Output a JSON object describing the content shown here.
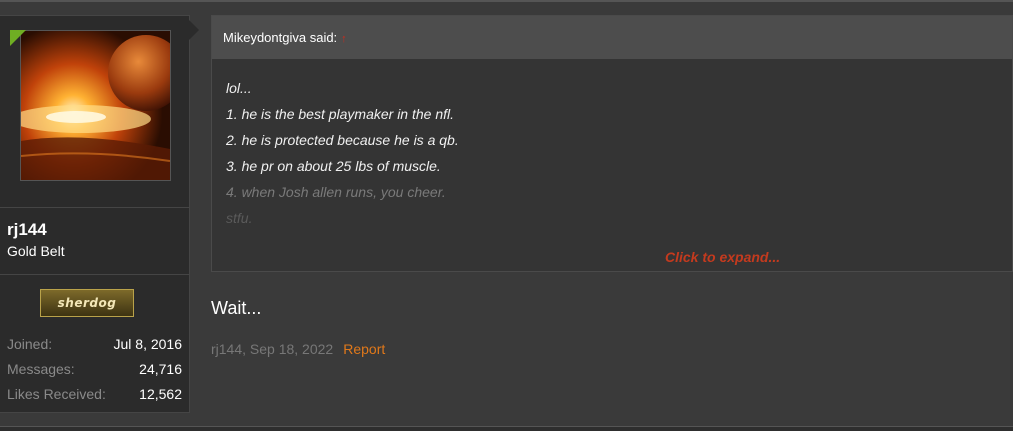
{
  "user": {
    "name": "rj144",
    "title": "Gold Belt",
    "badge": "sherdog",
    "stats": [
      {
        "label": "Joined:",
        "value": "Jul 8, 2016"
      },
      {
        "label": "Messages:",
        "value": "24,716"
      },
      {
        "label": "Likes Received:",
        "value": "12,562"
      }
    ],
    "online_color": "#6fae23"
  },
  "quote": {
    "author_said": "Mikeydontgiva said:",
    "arrow": "↑",
    "lines": [
      "lol...",
      "1. he is the best playmaker in the nfl.",
      "2. he is protected because he is a qb.",
      "3. he pr on about 25 lbs of muscle.",
      "4. when Josh allen runs, you cheer.",
      "stfu."
    ],
    "expand_label": "Click to expand..."
  },
  "post": {
    "message": "Wait...",
    "meta": "rj144, Sep 18, 2022",
    "report_label": "Report"
  },
  "colors": {
    "background": "#3a3a3a",
    "sidebar": "#2b2b2b",
    "accent_red": "#c43a1e",
    "report_orange": "#e0781a"
  }
}
